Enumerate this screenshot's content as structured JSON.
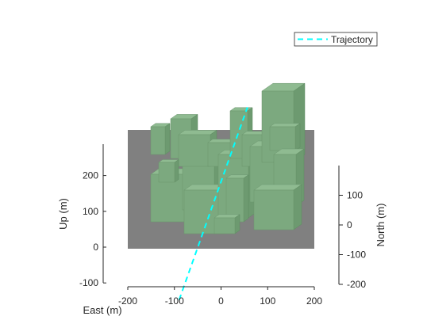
{
  "chart_data": {
    "type": "3d-scene",
    "title": "",
    "axes": {
      "up": {
        "label": "Up (m)",
        "ticks": [
          -100,
          0,
          100,
          200
        ],
        "tick_labels": [
          "-100",
          "0",
          "100",
          "200"
        ],
        "range": [
          -100,
          300
        ]
      },
      "east": {
        "label": "East (m)",
        "ticks": [
          -200,
          -100,
          0,
          100,
          200
        ],
        "tick_labels": [
          "-200",
          "-100",
          "0",
          "100",
          "200"
        ],
        "range": [
          -200,
          200
        ]
      },
      "north": {
        "label": "North (m)",
        "ticks": [
          -200,
          -100,
          0,
          100
        ],
        "tick_labels": [
          "-200",
          "-100",
          "0",
          "100"
        ],
        "range": [
          -200,
          200
        ]
      }
    },
    "grid": false,
    "legend": {
      "placement": "top-right",
      "entries": [
        {
          "name": "Trajectory",
          "style": "dashed",
          "color": "#00FFFF"
        }
      ]
    },
    "series": [
      {
        "name": "Trajectory",
        "kind": "line3d",
        "east": [
          -95,
          60
        ],
        "north": [
          20,
          20
        ],
        "up": [
          180,
          395
        ]
      }
    ],
    "scene": {
      "ground_color": "#808080",
      "building_color": "#7BA77E",
      "ground_extent_east": [
        -200,
        200
      ],
      "ground_extent_north": [
        -200,
        200
      ]
    }
  }
}
